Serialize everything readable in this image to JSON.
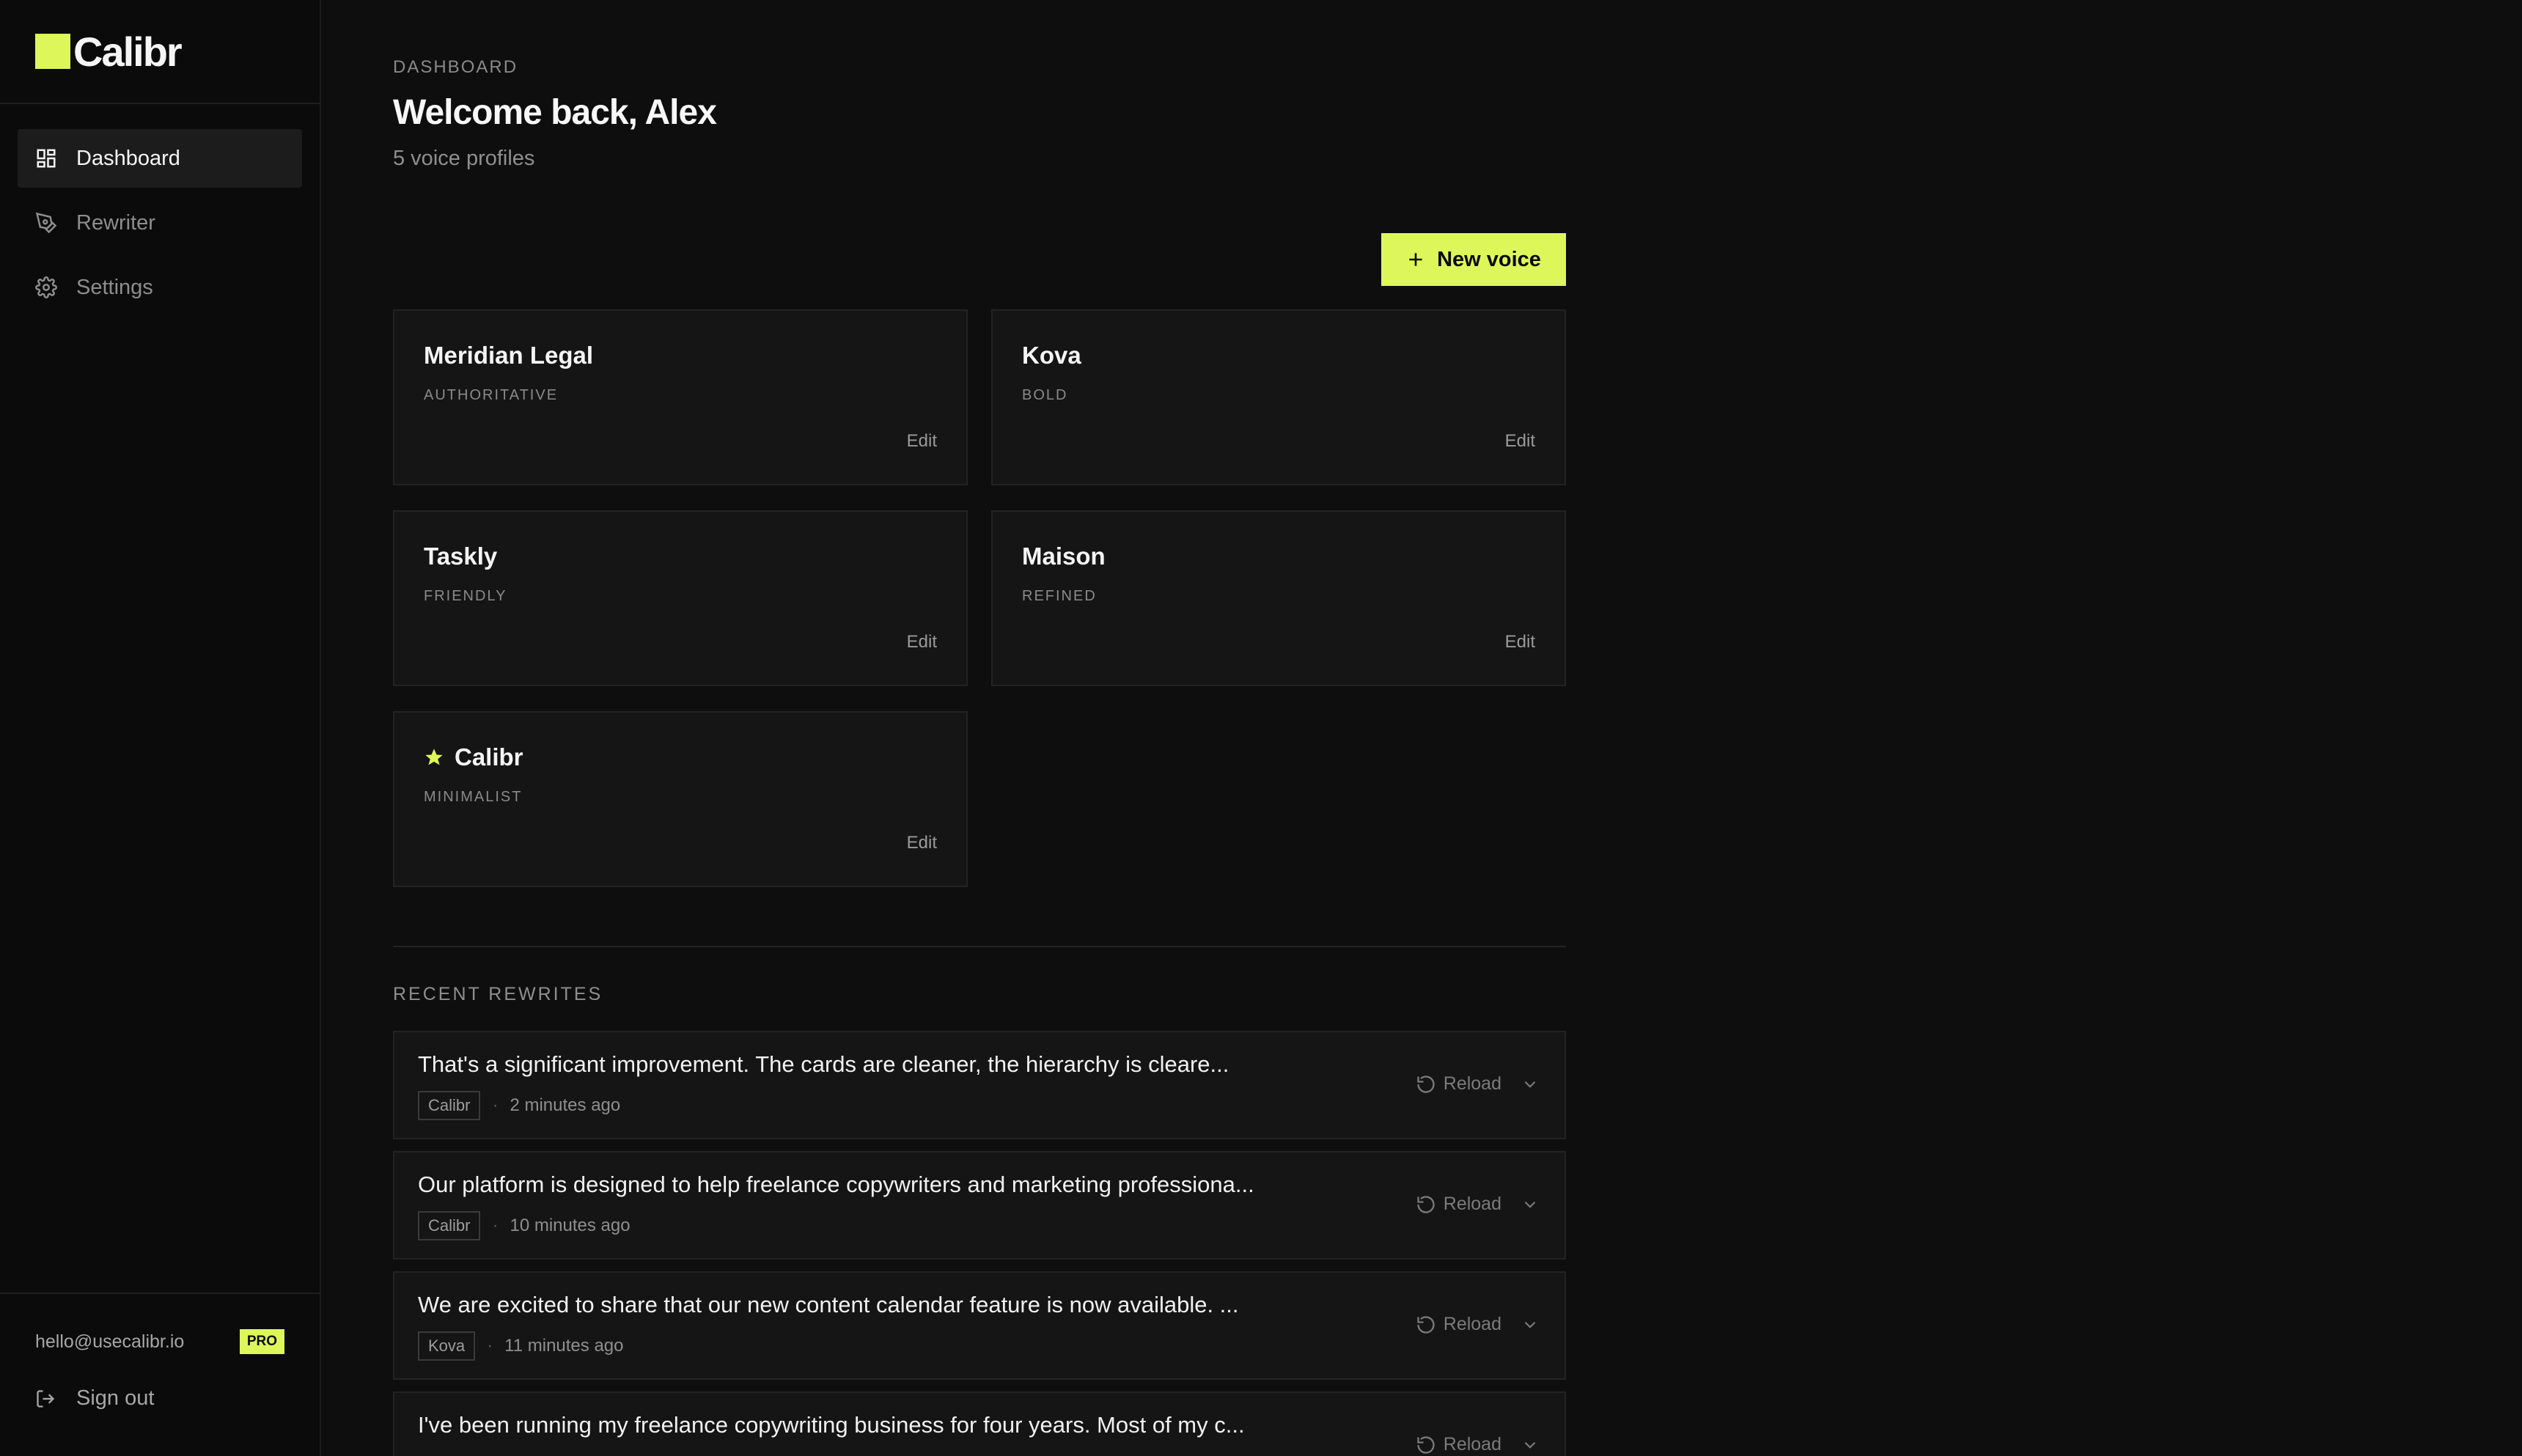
{
  "brand": {
    "name": "Calibr",
    "accent": "#ddf75a"
  },
  "sidebar": {
    "items": [
      {
        "label": "Dashboard",
        "icon": "dashboard-grid-icon",
        "active": true
      },
      {
        "label": "Rewriter",
        "icon": "pen-nib-icon",
        "active": false
      },
      {
        "label": "Settings",
        "icon": "gear-icon",
        "active": false
      }
    ],
    "account": {
      "email": "hello@usecalibr.io",
      "plan": "PRO"
    },
    "signout": "Sign out"
  },
  "header": {
    "eyebrow": "DASHBOARD",
    "title": "Welcome back, Alex",
    "subtitle": "5 voice profiles"
  },
  "actions": {
    "new_voice": "New voice"
  },
  "voices": [
    {
      "name": "Meridian Legal",
      "tone": "AUTHORITATIVE",
      "edit": "Edit",
      "starred": false
    },
    {
      "name": "Kova",
      "tone": "BOLD",
      "edit": "Edit",
      "starred": false
    },
    {
      "name": "Taskly",
      "tone": "FRIENDLY",
      "edit": "Edit",
      "starred": false
    },
    {
      "name": "Maison",
      "tone": "REFINED",
      "edit": "Edit",
      "starred": false
    },
    {
      "name": "Calibr",
      "tone": "MINIMALIST",
      "edit": "Edit",
      "starred": true
    }
  ],
  "recent": {
    "label": "RECENT REWRITES",
    "reload_label": "Reload",
    "items": [
      {
        "text": "That's a significant improvement. The cards are cleaner, the hierarchy is cleare...",
        "voice": "Calibr",
        "sep": "·",
        "time": "2 minutes ago"
      },
      {
        "text": "Our platform is designed to help freelance copywriters and marketing professiona...",
        "voice": "Calibr",
        "sep": "·",
        "time": "10 minutes ago"
      },
      {
        "text": "We are excited to share that our new content calendar feature is now available. ...",
        "voice": "Kova",
        "sep": "·",
        "time": "11 minutes ago"
      },
      {
        "text": "I've been running my freelance copywriting business for four years. Most of my c...",
        "voice": "",
        "sep": "",
        "time": ""
      }
    ]
  }
}
